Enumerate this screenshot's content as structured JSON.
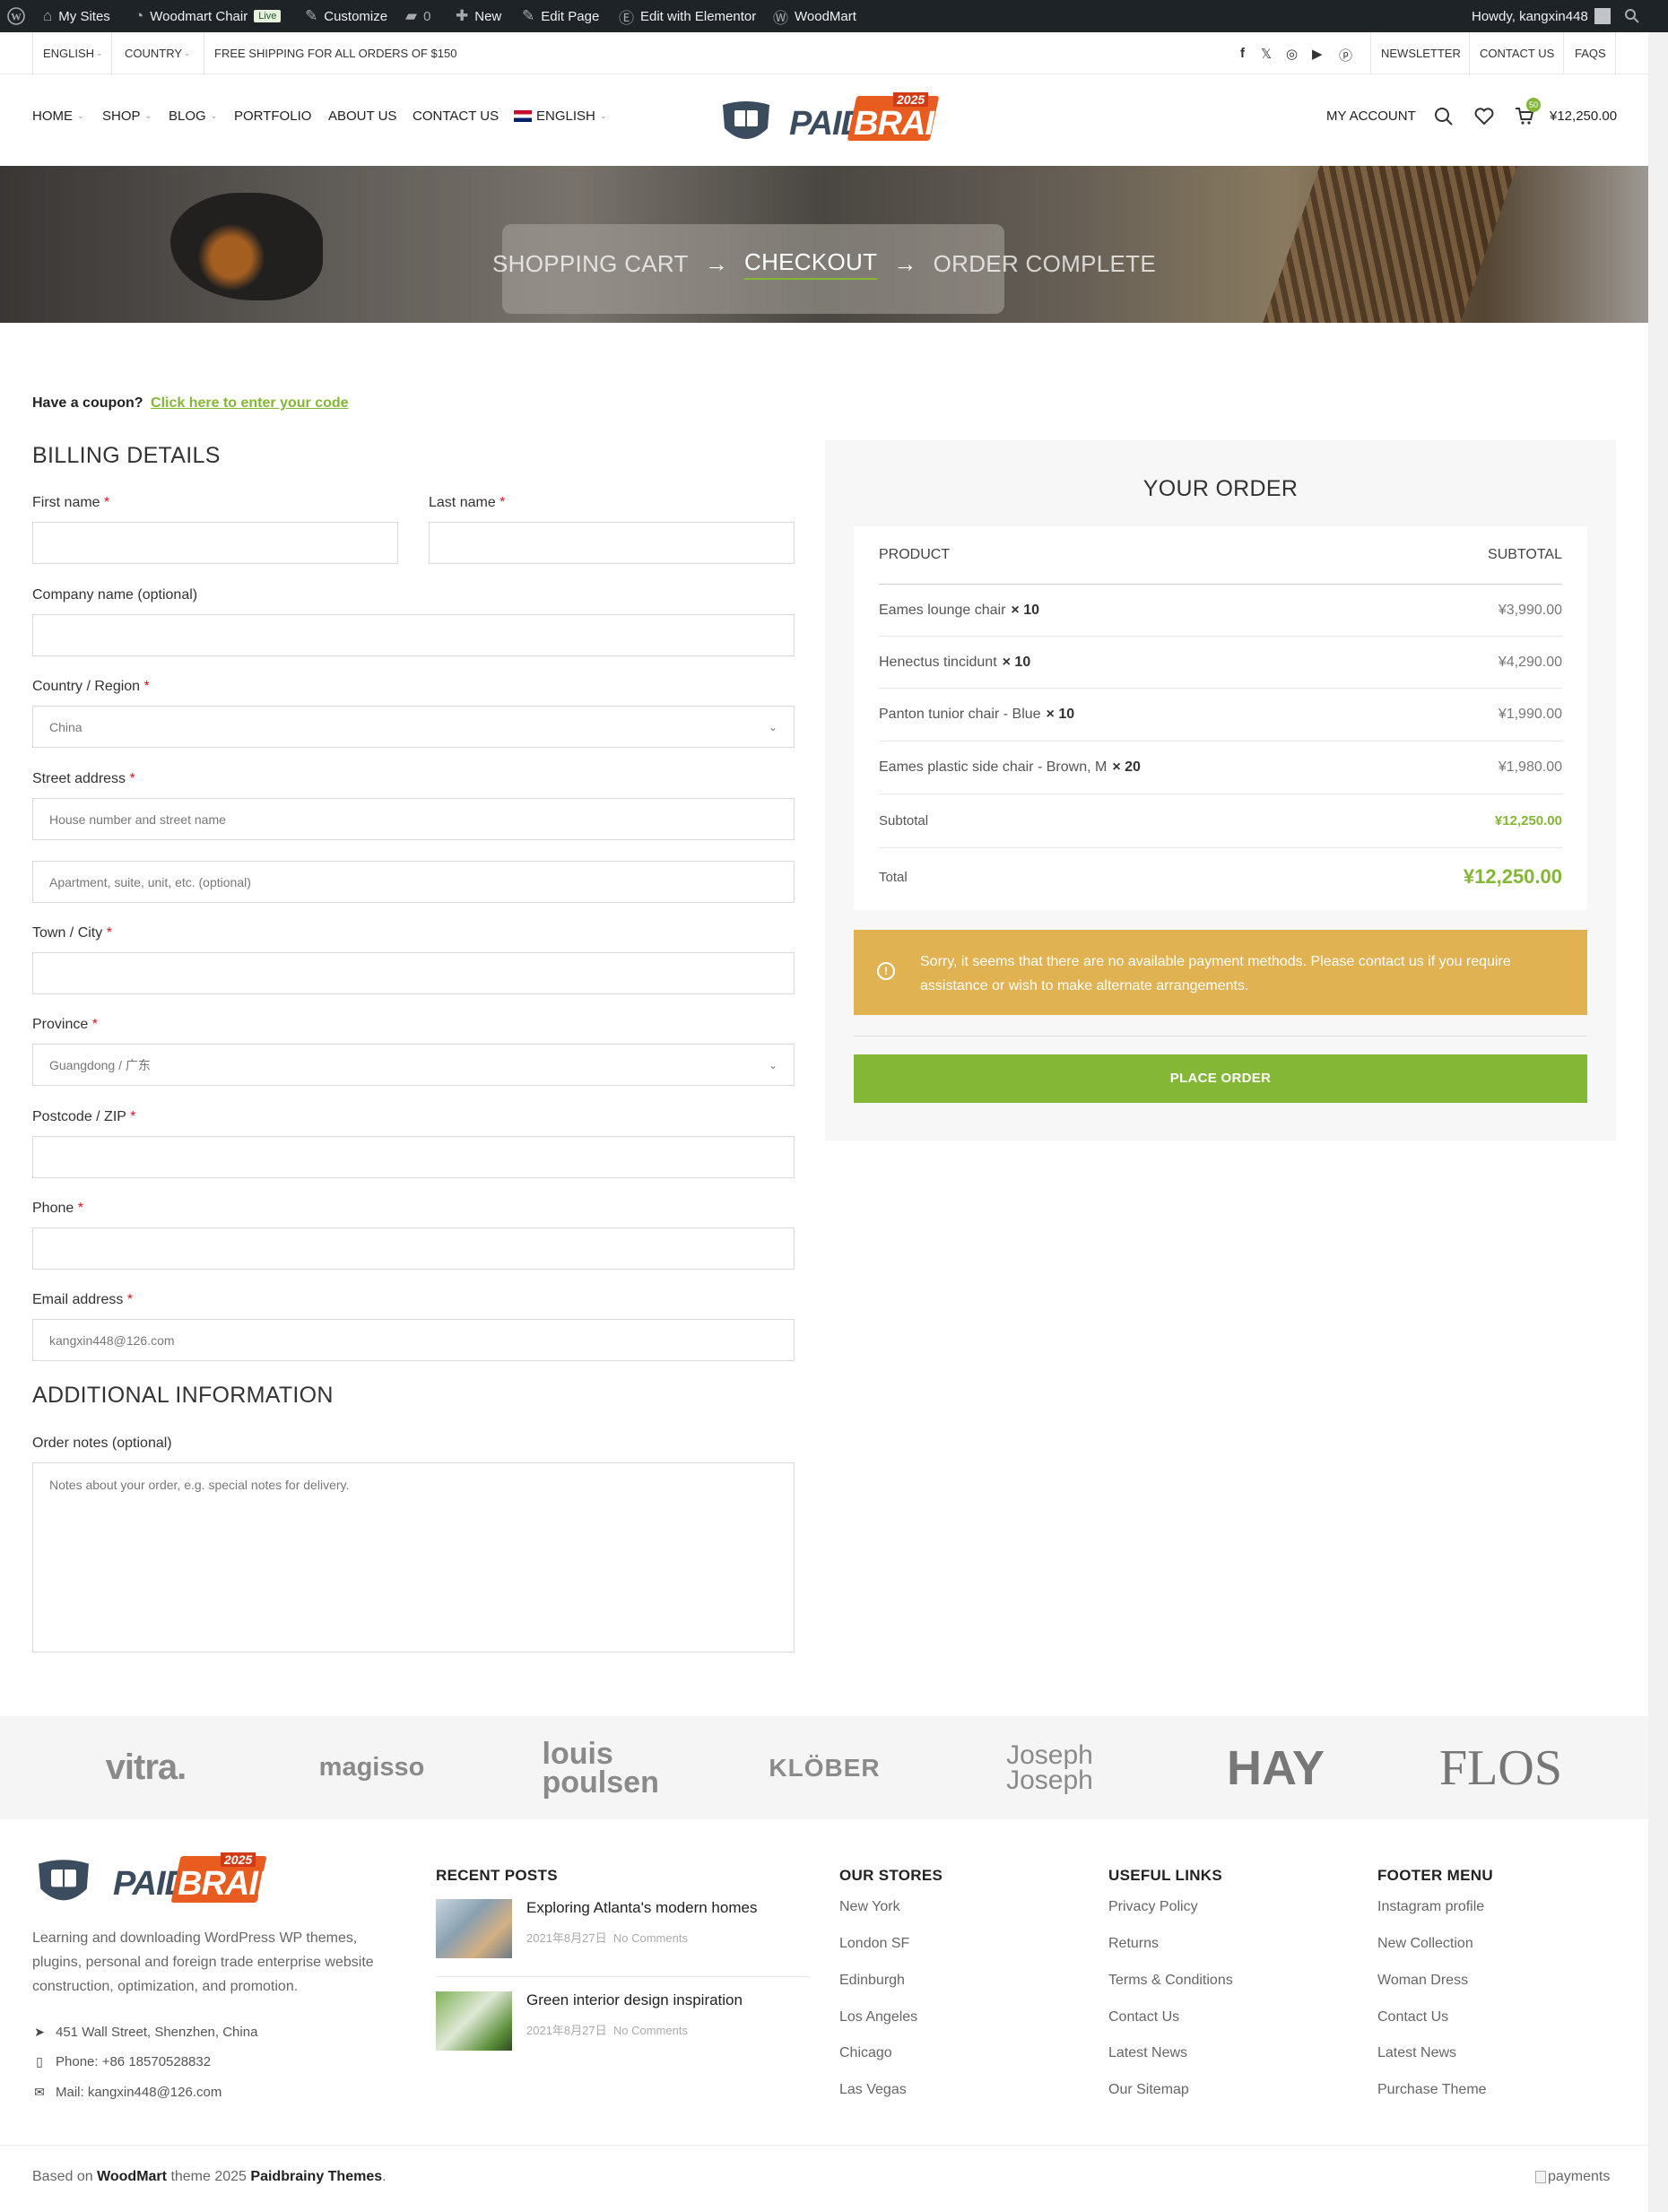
{
  "admin_bar": {
    "my_sites": "My Sites",
    "site_name": "Woodmart Chair",
    "live_badge": "Live",
    "customize": "Customize",
    "comments_count": "0",
    "new": "New",
    "edit_page": "Edit Page",
    "edit_elementor": "Edit with Elementor",
    "woodmart": "WoodMart",
    "howdy": "Howdy, kangxin448"
  },
  "topbar": {
    "language": "ENGLISH",
    "country": "COUNTRY",
    "shipping_note": "FREE SHIPPING FOR ALL ORDERS OF $150",
    "links": [
      "NEWSLETTER",
      "CONTACT US",
      "FAQS"
    ]
  },
  "header": {
    "nav": [
      "HOME",
      "SHOP",
      "BLOG",
      "PORTFOLIO",
      "ABOUT US",
      "CONTACT US",
      "ENGLISH"
    ],
    "logo_paid": "PAID",
    "logo_brainy": "BRAINY",
    "logo_year": "2025",
    "my_account": "MY ACCOUNT",
    "cart_count": "50",
    "cart_total": "¥12,250.00"
  },
  "hero": {
    "steps": [
      "SHOPPING CART",
      "CHECKOUT",
      "ORDER COMPLETE"
    ]
  },
  "coupon": {
    "question": "Have a coupon?",
    "link": "Click here to enter your code"
  },
  "billing": {
    "title": "BILLING DETAILS",
    "first_name": "First name",
    "last_name": "Last name",
    "company": "Company name (optional)",
    "country_label": "Country / Region",
    "country_value": "China",
    "street_label": "Street address",
    "street_placeholder": "House number and street name",
    "street2_placeholder": "Apartment, suite, unit, etc. (optional)",
    "city": "Town / City",
    "province_label": "Province",
    "province_value": "Guangdong / 广东",
    "postcode": "Postcode / ZIP",
    "phone": "Phone",
    "email_label": "Email address",
    "email_value": "kangxin448@126.com",
    "req": "*"
  },
  "additional": {
    "title": "ADDITIONAL INFORMATION",
    "notes_label": "Order notes (optional)",
    "notes_placeholder": "Notes about your order, e.g. special notes for delivery."
  },
  "order": {
    "title": "YOUR ORDER",
    "col_product": "PRODUCT",
    "col_subtotal": "SUBTOTAL",
    "items": [
      {
        "name": "Eames lounge chair",
        "qty": "× 10",
        "price": "¥3,990.00"
      },
      {
        "name": "Henectus tincidunt",
        "qty": "× 10",
        "price": "¥4,290.00"
      },
      {
        "name": "Panton tunior chair - Blue",
        "qty": "× 10",
        "price": "¥1,990.00"
      },
      {
        "name": "Eames plastic side chair - Brown, M",
        "qty": "× 20",
        "price": "¥1,980.00"
      }
    ],
    "subtotal_label": "Subtotal",
    "subtotal_value": "¥12,250.00",
    "total_label": "Total",
    "total_value": "¥12,250.00",
    "notice": "Sorry, it seems that there are no available payment methods. Please contact us if you require assistance or wish to make alternate arrangements.",
    "place_order": "PLACE ORDER"
  },
  "brands": [
    "vitra.",
    "magisso",
    "louis poulsen",
    "KLÖBER",
    "Joseph Joseph",
    "HAY",
    "FLOS"
  ],
  "footer": {
    "about": "Learning and downloading WordPress WP themes, plugins, personal and foreign trade enterprise website construction, optimization, and promotion.",
    "address": "451 Wall Street, Shenzhen, China",
    "phone": "Phone: +86 18570528832",
    "mail": "Mail: kangxin448@126.com",
    "recent_posts_title": "RECENT POSTS",
    "posts": [
      {
        "title": "Exploring Atlanta's modern homes",
        "date": "2021年8月27日",
        "comments": "No Comments"
      },
      {
        "title": "Green interior design inspiration",
        "date": "2021年8月27日",
        "comments": "No Comments"
      }
    ],
    "stores_title": "OUR STORES",
    "stores": [
      "New York",
      "London SF",
      "Edinburgh",
      "Los Angeles",
      "Chicago",
      "Las Vegas"
    ],
    "useful_title": "USEFUL LINKS",
    "useful": [
      "Privacy Policy",
      "Returns",
      "Terms & Conditions",
      "Contact Us",
      "Latest News",
      "Our Sitemap"
    ],
    "menu_title": "FOOTER MENU",
    "menu": [
      "Instagram profile",
      "New Collection",
      "Woman Dress",
      "Contact Us",
      "Latest News",
      "Purchase Theme"
    ],
    "copyright_pre": "Based on",
    "copyright_theme": "WoodMart",
    "copyright_mid": "theme 2025",
    "copyright_brand": "Paidbrainy Themes",
    "copyright_end": ".",
    "payments_alt": "payments"
  },
  "colors": {
    "accent": "#83b735",
    "notice": "#e0b252",
    "adminbar": "#1d2327"
  }
}
